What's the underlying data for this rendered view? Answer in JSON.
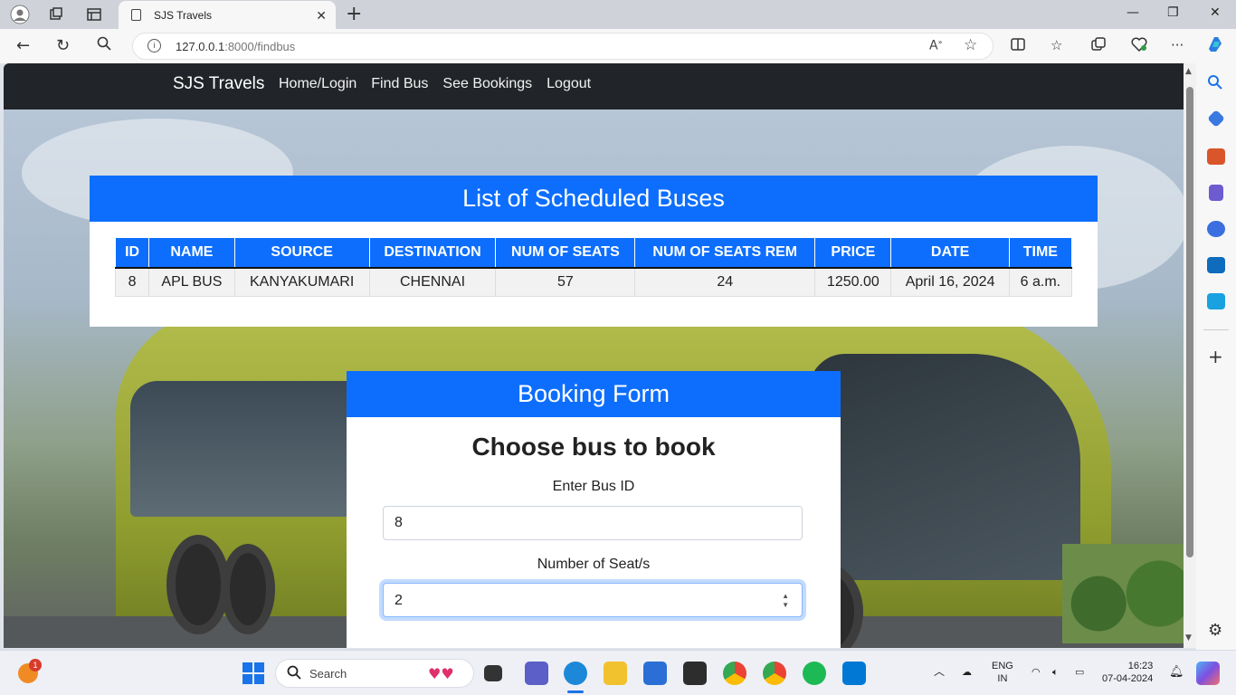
{
  "browser": {
    "tab_title": "SJS Travels",
    "url_host": "127.0.0.1",
    "url_rest": ":8000/findbus"
  },
  "navbar": {
    "brand": "SJS Travels",
    "links": [
      "Home/Login",
      "Find Bus",
      "See Bookings",
      "Logout"
    ]
  },
  "schedule": {
    "title": "List of Scheduled Buses",
    "columns": [
      "ID",
      "NAME",
      "SOURCE",
      "DESTINATION",
      "NUM OF SEATS",
      "NUM OF SEATS REM",
      "PRICE",
      "DATE",
      "TIME"
    ],
    "rows": [
      [
        "8",
        "APL BUS",
        "KANYAKUMARI",
        "CHENNAI",
        "57",
        "24",
        "1250.00",
        "April 16, 2024",
        "6 a.m."
      ]
    ]
  },
  "booking": {
    "title": "Booking Form",
    "subtitle": "Choose bus to book",
    "bus_id_label": "Enter Bus ID",
    "bus_id_value": "8",
    "seats_label": "Number of Seat/s",
    "seats_value": "2"
  },
  "taskbar": {
    "search_placeholder": "Search",
    "notification_count": "1",
    "lang_top": "ENG",
    "lang_bottom": "IN",
    "time": "16:23",
    "date": "07-04-2024"
  },
  "colors": {
    "primary": "#0d6efd",
    "navbar": "#212529"
  }
}
